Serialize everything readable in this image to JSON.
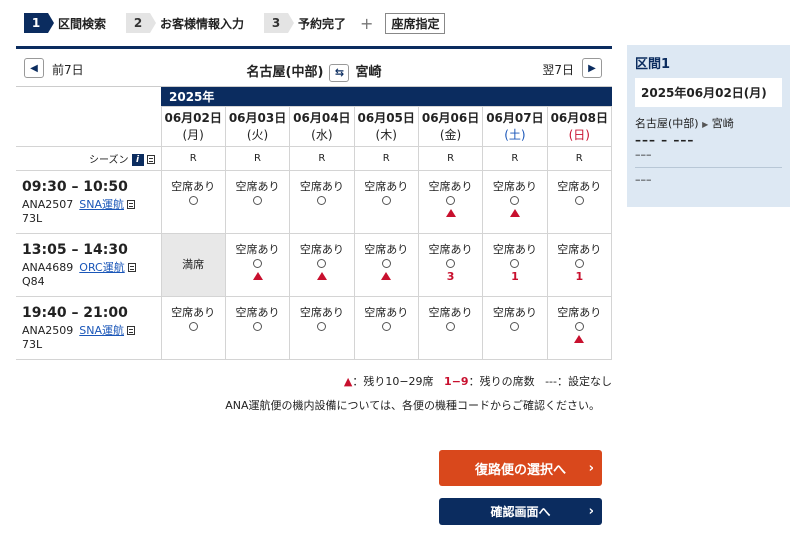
{
  "steps": [
    {
      "num": "1",
      "label": "区間検索"
    },
    {
      "num": "2",
      "label": "お客様情報入力"
    },
    {
      "num": "3",
      "label": "予約完了"
    }
  ],
  "plus": "+",
  "seat_spec": "座席指定",
  "nav": {
    "prev_label": "前7日",
    "next_label": "翌7日",
    "origin": "名古屋(中部)",
    "destination": "宮崎"
  },
  "year": "2025年",
  "dates": [
    {
      "date": "06月02日",
      "weekday": "(月)"
    },
    {
      "date": "06月03日",
      "weekday": "(火)"
    },
    {
      "date": "06月04日",
      "weekday": "(水)"
    },
    {
      "date": "06月05日",
      "weekday": "(木)"
    },
    {
      "date": "06月06日",
      "weekday": "(金)"
    },
    {
      "date": "06月07日",
      "weekday": "(土)"
    },
    {
      "date": "06月08日",
      "weekday": "(日)"
    }
  ],
  "season_label": "シーズン",
  "seasons": [
    "R",
    "R",
    "R",
    "R",
    "R",
    "R",
    "R"
  ],
  "flights": [
    {
      "time": "09:30 – 10:50",
      "number": "ANA2507",
      "operator": "SNA運航",
      "aircraft": "73L",
      "seats": [
        {
          "status": "空席あり",
          "note": ""
        },
        {
          "status": "空席あり",
          "note": ""
        },
        {
          "status": "空席あり",
          "note": ""
        },
        {
          "status": "空席あり",
          "note": ""
        },
        {
          "status": "空席あり",
          "note": "▲"
        },
        {
          "status": "空席あり",
          "note": "▲"
        },
        {
          "status": "空席あり",
          "note": ""
        }
      ]
    },
    {
      "time": "13:05 – 14:30",
      "number": "ANA4689",
      "operator": "ORC運航",
      "aircraft": "Q84",
      "seats": [
        {
          "status": "満席",
          "note": ""
        },
        {
          "status": "空席あり",
          "note": "▲"
        },
        {
          "status": "空席あり",
          "note": "▲"
        },
        {
          "status": "空席あり",
          "note": "▲"
        },
        {
          "status": "空席あり",
          "note": "3"
        },
        {
          "status": "空席あり",
          "note": "1"
        },
        {
          "status": "空席あり",
          "note": "1"
        }
      ]
    },
    {
      "time": "19:40 – 21:00",
      "number": "ANA2509",
      "operator": "SNA運航",
      "aircraft": "73L",
      "seats": [
        {
          "status": "空席あり",
          "note": ""
        },
        {
          "status": "空席あり",
          "note": ""
        },
        {
          "status": "空席あり",
          "note": ""
        },
        {
          "status": "空席あり",
          "note": ""
        },
        {
          "status": "空席あり",
          "note": ""
        },
        {
          "status": "空席あり",
          "note": ""
        },
        {
          "status": "空席あり",
          "note": "▲"
        }
      ]
    }
  ],
  "legend": {
    "tri_symbol": "▲",
    "tri_text": "：残り10−29席",
    "range": "1−9",
    "range_text": "：残りの席数",
    "dash": "---",
    "dash_text": "：設定なし"
  },
  "note": "ANA運航便の機内設備については、各便の機種コードからご確認ください。",
  "buttons": {
    "return": "復路便の選択へ",
    "confirm": "確認画面へ"
  },
  "side": {
    "title": "区間1",
    "date": "2025年06月02日(月)",
    "origin": "名古屋(中部)",
    "destination": "宮崎",
    "flight_placeholder": "––– – –––",
    "line1": "–––",
    "line2": "–––"
  },
  "colors": {
    "navy": "#0b2c5f",
    "orange": "#d9481c",
    "red": "#c8102e",
    "side_bg": "#dde8f3"
  }
}
